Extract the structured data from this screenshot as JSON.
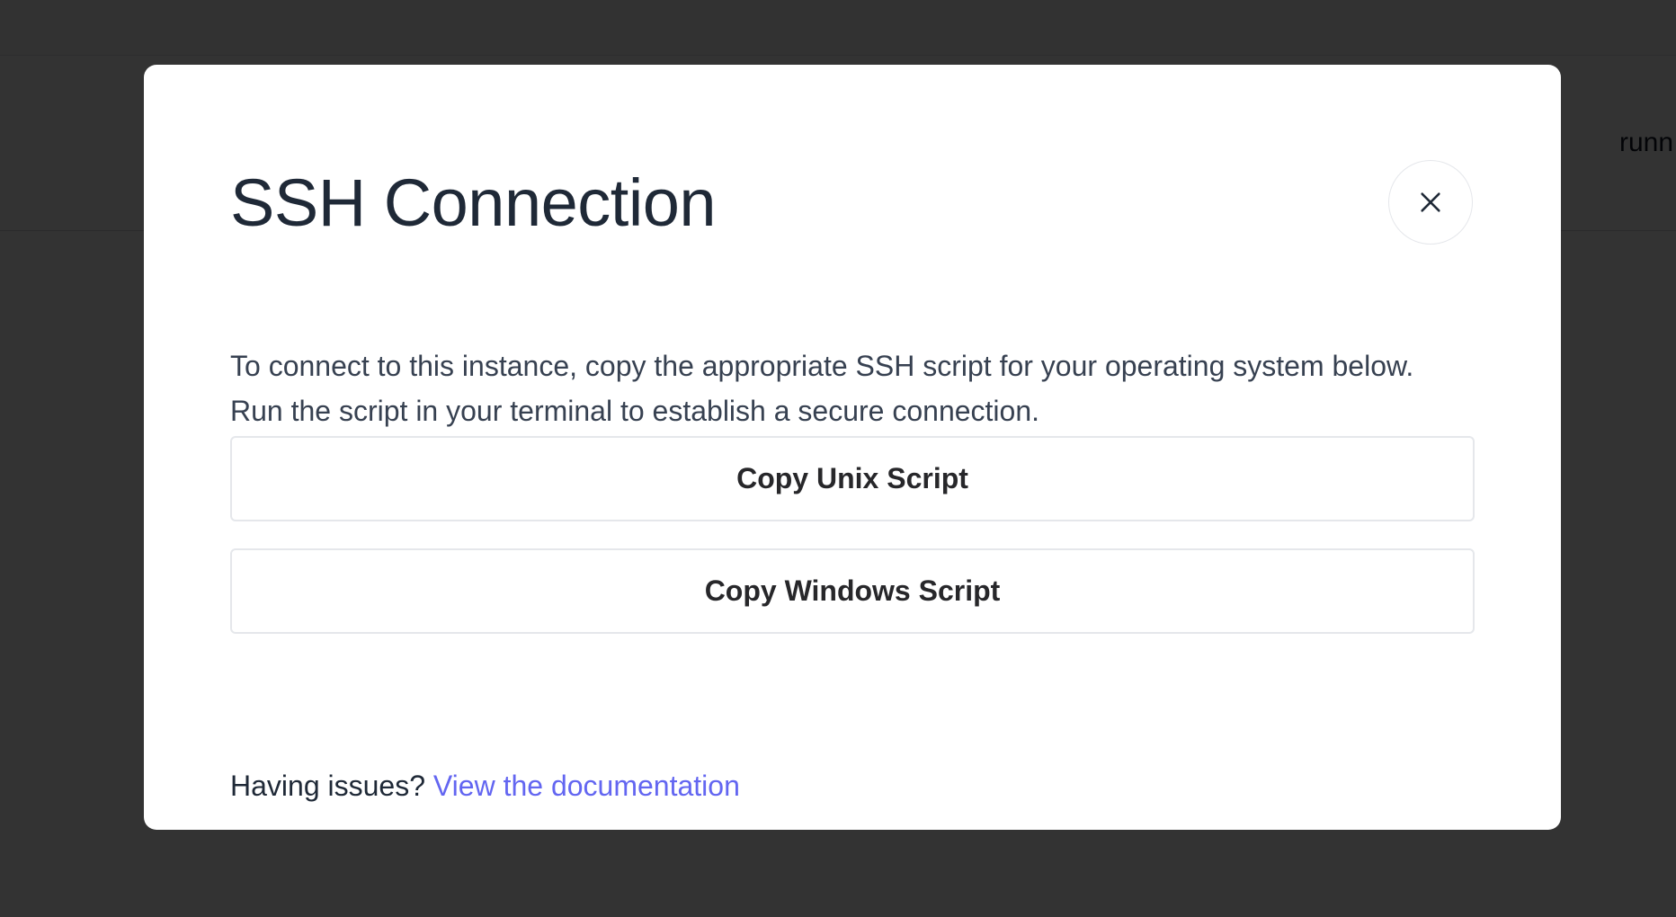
{
  "background": {
    "status_text": "runn"
  },
  "modal": {
    "title": "SSH Connection",
    "close_icon": "close-icon",
    "description": "To connect to this instance, copy the appropriate SSH script for your operating system below. Run the script in your terminal to establish a secure connection.",
    "buttons": {
      "unix_label": "Copy Unix Script",
      "windows_label": "Copy Windows Script"
    },
    "footer": {
      "prompt": "Having issues?",
      "link_label": "View the documentation"
    }
  },
  "colors": {
    "overlay": "#333333",
    "modal_bg": "#ffffff",
    "title": "#1f2937",
    "link": "#6366f1",
    "button_border": "#e5e7eb"
  }
}
